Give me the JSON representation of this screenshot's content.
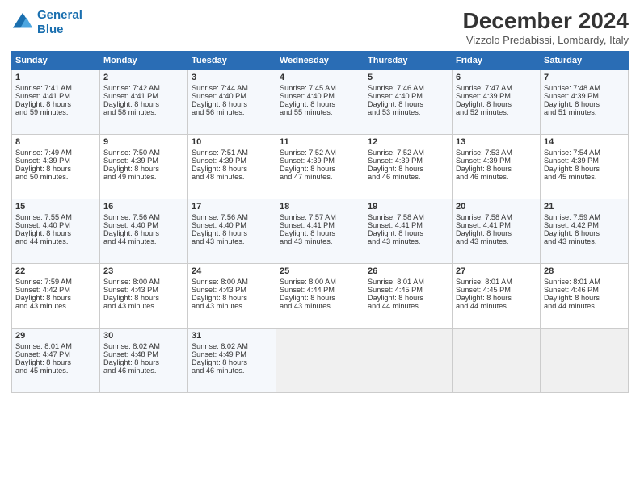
{
  "logo": {
    "line1": "General",
    "line2": "Blue"
  },
  "title": "December 2024",
  "subtitle": "Vizzolo Predabissi, Lombardy, Italy",
  "weekdays": [
    "Sunday",
    "Monday",
    "Tuesday",
    "Wednesday",
    "Thursday",
    "Friday",
    "Saturday"
  ],
  "weeks": [
    [
      {
        "day": "1",
        "lines": [
          "Sunrise: 7:41 AM",
          "Sunset: 4:41 PM",
          "Daylight: 8 hours",
          "and 59 minutes."
        ]
      },
      {
        "day": "2",
        "lines": [
          "Sunrise: 7:42 AM",
          "Sunset: 4:41 PM",
          "Daylight: 8 hours",
          "and 58 minutes."
        ]
      },
      {
        "day": "3",
        "lines": [
          "Sunrise: 7:44 AM",
          "Sunset: 4:40 PM",
          "Daylight: 8 hours",
          "and 56 minutes."
        ]
      },
      {
        "day": "4",
        "lines": [
          "Sunrise: 7:45 AM",
          "Sunset: 4:40 PM",
          "Daylight: 8 hours",
          "and 55 minutes."
        ]
      },
      {
        "day": "5",
        "lines": [
          "Sunrise: 7:46 AM",
          "Sunset: 4:40 PM",
          "Daylight: 8 hours",
          "and 53 minutes."
        ]
      },
      {
        "day": "6",
        "lines": [
          "Sunrise: 7:47 AM",
          "Sunset: 4:39 PM",
          "Daylight: 8 hours",
          "and 52 minutes."
        ]
      },
      {
        "day": "7",
        "lines": [
          "Sunrise: 7:48 AM",
          "Sunset: 4:39 PM",
          "Daylight: 8 hours",
          "and 51 minutes."
        ]
      }
    ],
    [
      {
        "day": "8",
        "lines": [
          "Sunrise: 7:49 AM",
          "Sunset: 4:39 PM",
          "Daylight: 8 hours",
          "and 50 minutes."
        ]
      },
      {
        "day": "9",
        "lines": [
          "Sunrise: 7:50 AM",
          "Sunset: 4:39 PM",
          "Daylight: 8 hours",
          "and 49 minutes."
        ]
      },
      {
        "day": "10",
        "lines": [
          "Sunrise: 7:51 AM",
          "Sunset: 4:39 PM",
          "Daylight: 8 hours",
          "and 48 minutes."
        ]
      },
      {
        "day": "11",
        "lines": [
          "Sunrise: 7:52 AM",
          "Sunset: 4:39 PM",
          "Daylight: 8 hours",
          "and 47 minutes."
        ]
      },
      {
        "day": "12",
        "lines": [
          "Sunrise: 7:52 AM",
          "Sunset: 4:39 PM",
          "Daylight: 8 hours",
          "and 46 minutes."
        ]
      },
      {
        "day": "13",
        "lines": [
          "Sunrise: 7:53 AM",
          "Sunset: 4:39 PM",
          "Daylight: 8 hours",
          "and 46 minutes."
        ]
      },
      {
        "day": "14",
        "lines": [
          "Sunrise: 7:54 AM",
          "Sunset: 4:39 PM",
          "Daylight: 8 hours",
          "and 45 minutes."
        ]
      }
    ],
    [
      {
        "day": "15",
        "lines": [
          "Sunrise: 7:55 AM",
          "Sunset: 4:40 PM",
          "Daylight: 8 hours",
          "and 44 minutes."
        ]
      },
      {
        "day": "16",
        "lines": [
          "Sunrise: 7:56 AM",
          "Sunset: 4:40 PM",
          "Daylight: 8 hours",
          "and 44 minutes."
        ]
      },
      {
        "day": "17",
        "lines": [
          "Sunrise: 7:56 AM",
          "Sunset: 4:40 PM",
          "Daylight: 8 hours",
          "and 43 minutes."
        ]
      },
      {
        "day": "18",
        "lines": [
          "Sunrise: 7:57 AM",
          "Sunset: 4:41 PM",
          "Daylight: 8 hours",
          "and 43 minutes."
        ]
      },
      {
        "day": "19",
        "lines": [
          "Sunrise: 7:58 AM",
          "Sunset: 4:41 PM",
          "Daylight: 8 hours",
          "and 43 minutes."
        ]
      },
      {
        "day": "20",
        "lines": [
          "Sunrise: 7:58 AM",
          "Sunset: 4:41 PM",
          "Daylight: 8 hours",
          "and 43 minutes."
        ]
      },
      {
        "day": "21",
        "lines": [
          "Sunrise: 7:59 AM",
          "Sunset: 4:42 PM",
          "Daylight: 8 hours",
          "and 43 minutes."
        ]
      }
    ],
    [
      {
        "day": "22",
        "lines": [
          "Sunrise: 7:59 AM",
          "Sunset: 4:42 PM",
          "Daylight: 8 hours",
          "and 43 minutes."
        ]
      },
      {
        "day": "23",
        "lines": [
          "Sunrise: 8:00 AM",
          "Sunset: 4:43 PM",
          "Daylight: 8 hours",
          "and 43 minutes."
        ]
      },
      {
        "day": "24",
        "lines": [
          "Sunrise: 8:00 AM",
          "Sunset: 4:43 PM",
          "Daylight: 8 hours",
          "and 43 minutes."
        ]
      },
      {
        "day": "25",
        "lines": [
          "Sunrise: 8:00 AM",
          "Sunset: 4:44 PM",
          "Daylight: 8 hours",
          "and 43 minutes."
        ]
      },
      {
        "day": "26",
        "lines": [
          "Sunrise: 8:01 AM",
          "Sunset: 4:45 PM",
          "Daylight: 8 hours",
          "and 44 minutes."
        ]
      },
      {
        "day": "27",
        "lines": [
          "Sunrise: 8:01 AM",
          "Sunset: 4:45 PM",
          "Daylight: 8 hours",
          "and 44 minutes."
        ]
      },
      {
        "day": "28",
        "lines": [
          "Sunrise: 8:01 AM",
          "Sunset: 4:46 PM",
          "Daylight: 8 hours",
          "and 44 minutes."
        ]
      }
    ],
    [
      {
        "day": "29",
        "lines": [
          "Sunrise: 8:01 AM",
          "Sunset: 4:47 PM",
          "Daylight: 8 hours",
          "and 45 minutes."
        ]
      },
      {
        "day": "30",
        "lines": [
          "Sunrise: 8:02 AM",
          "Sunset: 4:48 PM",
          "Daylight: 8 hours",
          "and 46 minutes."
        ]
      },
      {
        "day": "31",
        "lines": [
          "Sunrise: 8:02 AM",
          "Sunset: 4:49 PM",
          "Daylight: 8 hours",
          "and 46 minutes."
        ]
      },
      null,
      null,
      null,
      null
    ]
  ]
}
